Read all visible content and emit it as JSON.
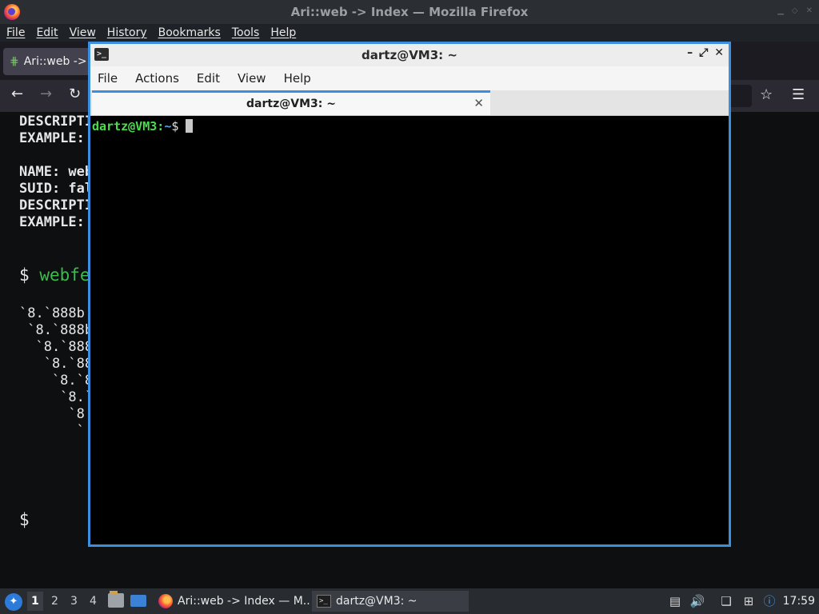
{
  "firefox": {
    "window_title": "Ari::web -> Index — Mozilla Firefox",
    "menu": [
      "File",
      "Edit",
      "View",
      "History",
      "Bookmarks",
      "Tools",
      "Help"
    ],
    "tab_label": "Ari::web ->",
    "content": {
      "lines_top": [
        "DESCRIPTI",
        "EXAMPLE:"
      ],
      "lines_mid": [
        "NAME: web",
        "SUID: fal",
        "DESCRIPTI",
        "EXAMPLE:"
      ],
      "prompt_symbol": "$",
      "prompt_command": "webfe",
      "ascii_art": [
        "`8.`888b",
        " `8.`888b",
        "  `8.`888",
        "   `8.`88",
        "    `8.`8",
        "     `8.`",
        "      `8",
        "       `"
      ],
      "bottom_prompt": "$"
    }
  },
  "terminal": {
    "window_title": "dartz@VM3: ~",
    "menu": [
      "File",
      "Actions",
      "Edit",
      "View",
      "Help"
    ],
    "tab_label": "dartz@VM3: ~",
    "prompt": {
      "user_host": "dartz@VM3",
      "separator": ":",
      "path": "~",
      "symbol": "$"
    }
  },
  "taskbar": {
    "workspaces": [
      "1",
      "2",
      "3",
      "4"
    ],
    "active_workspace": "1",
    "tasks": [
      {
        "label": "Ari::web -> Index — M...",
        "icon": "firefox-icon"
      },
      {
        "label": "dartz@VM3: ~",
        "icon": "terminal-icon"
      }
    ],
    "clock": "17:59"
  }
}
